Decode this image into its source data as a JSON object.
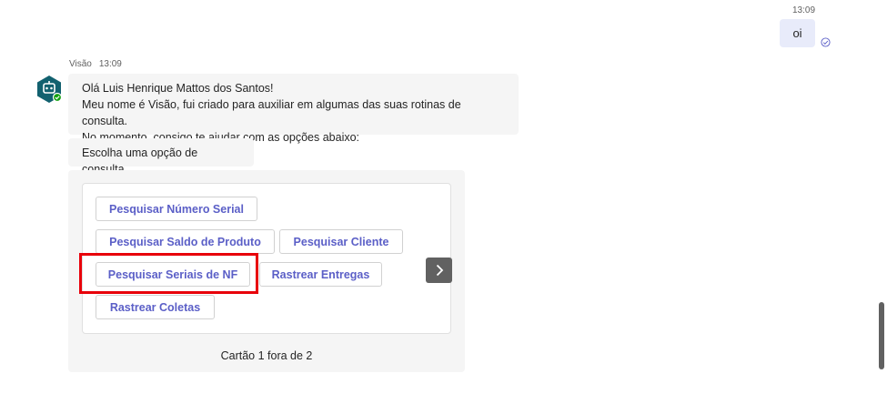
{
  "user_message": {
    "time": "13:09",
    "text": "oi"
  },
  "bot": {
    "name": "Visão",
    "time": "13:09",
    "greeting_lines": [
      "Olá Luis Henrique Mattos dos Santos!",
      "Meu nome é Visão, fui criado para auxiliar em algumas das suas rotinas de consulta.",
      "No momento, consigo te ajudar com as opções abaixo:"
    ],
    "prompt": "Escolha uma opção de consulta"
  },
  "card": {
    "buttons": [
      "Pesquisar Número Serial",
      "Pesquisar Saldo de Produto",
      "Pesquisar Cliente",
      "Pesquisar Seriais de NF",
      "Rastrear Entregas",
      "Rastrear Coletas"
    ],
    "counter": "Cartão 1 fora de 2"
  },
  "colors": {
    "accent": "#5b5fc7",
    "highlight": "#e8000a",
    "bubble_self": "#e8ebfa",
    "bubble_bot": "#f5f5f5"
  },
  "icons": [
    "read-receipt-icon",
    "bot-avatar-icon",
    "chevron-right-icon"
  ]
}
